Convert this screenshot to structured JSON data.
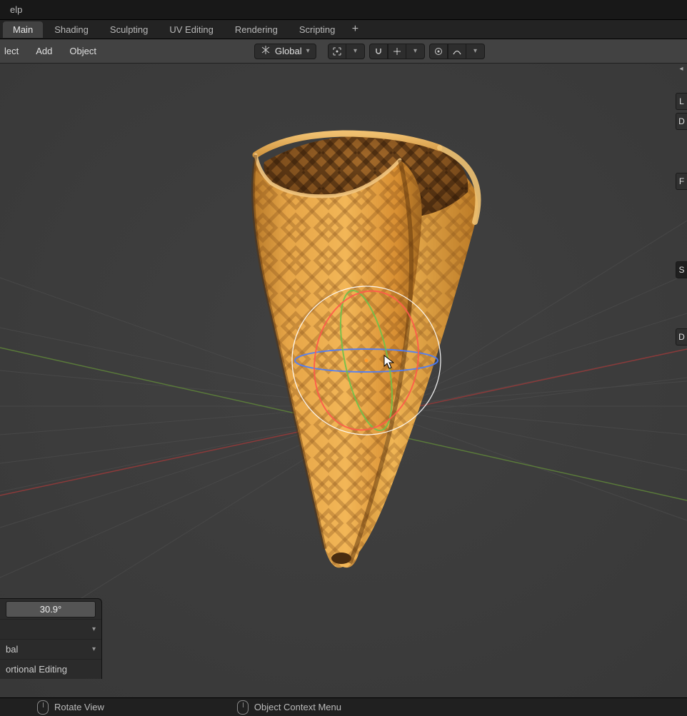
{
  "topmenu_cut": "elp",
  "workspace_tabs": [
    "Main",
    "Shading",
    "Sculpting",
    "UV Editing",
    "Rendering",
    "Scripting"
  ],
  "workspace_active": 0,
  "header": {
    "select_cut": "lect",
    "add": "Add",
    "object": "Object",
    "orientation": "Global"
  },
  "right_tabs": [
    "L",
    "D",
    "F",
    "S",
    "D"
  ],
  "operator_panel": {
    "angle": "30.9°",
    "orientation_cut": "bal",
    "prop_edit_cut": "ortional Editing"
  },
  "status": {
    "rotate_view": "Rotate View",
    "context_menu": "Object Context Menu"
  }
}
